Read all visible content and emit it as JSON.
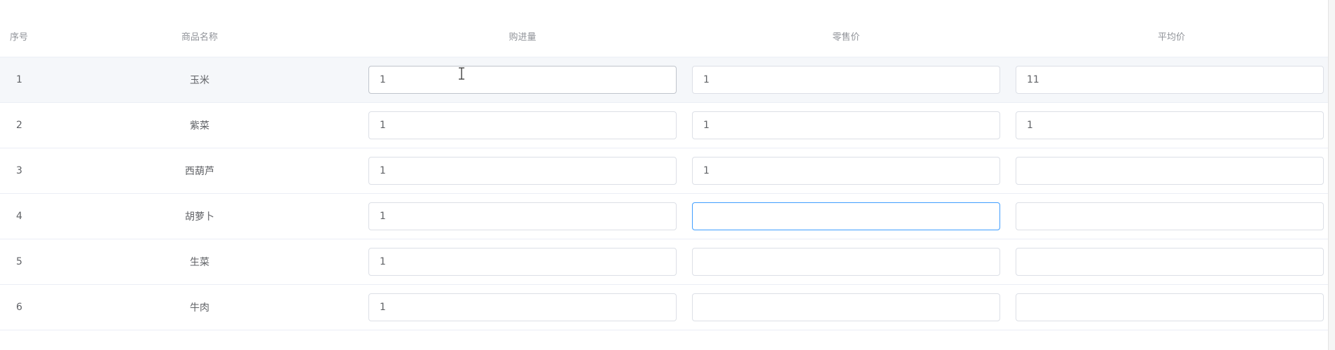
{
  "table": {
    "headers": {
      "index": "序号",
      "name": "商品名称",
      "purchase_qty": "购进量",
      "retail_price": "零售价",
      "avg_price": "平均价"
    },
    "rows": [
      {
        "index": "1",
        "name": "玉米",
        "purchase_qty": "1",
        "retail_price": "1",
        "avg_price": "11"
      },
      {
        "index": "2",
        "name": "紫菜",
        "purchase_qty": "1",
        "retail_price": "1",
        "avg_price": "1"
      },
      {
        "index": "3",
        "name": "西葫芦",
        "purchase_qty": "1",
        "retail_price": "1",
        "avg_price": ""
      },
      {
        "index": "4",
        "name": "胡萝卜",
        "purchase_qty": "1",
        "retail_price": "",
        "avg_price": ""
      },
      {
        "index": "5",
        "name": "生菜",
        "purchase_qty": "1",
        "retail_price": "",
        "avg_price": ""
      },
      {
        "index": "6",
        "name": "牛肉",
        "purchase_qty": "1",
        "retail_price": "",
        "avg_price": ""
      }
    ]
  },
  "state": {
    "hovered_row": 1,
    "focused_field": "row4-retail_price"
  },
  "colors": {
    "focus_border": "#409eff",
    "input_border": "#dcdfe6",
    "row_hover_bg": "#f5f7fa",
    "header_text": "#909399",
    "body_text": "#606266"
  }
}
